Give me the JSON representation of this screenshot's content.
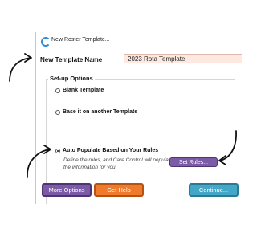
{
  "window": {
    "title": "New Roster Template..."
  },
  "template_name": {
    "label": "New Template Name",
    "value": "2023 Rota Template"
  },
  "setup_options": {
    "caption": "Set-up Options",
    "options": [
      {
        "label": "Blank Template",
        "selected": false
      },
      {
        "label": "Base it on another Template",
        "selected": false
      },
      {
        "label": "Auto Populate Based on Your Rules",
        "selected": true
      }
    ],
    "auto_help": "Define the rules, and Care Control will populate the information for you.",
    "set_rules_label": "Set Rules..."
  },
  "footer": {
    "more_options_label": "More Options",
    "get_help_label": "Get Help",
    "continue_label": "Continue..."
  },
  "colors": {
    "purple_button": "#7b5aa6",
    "orange_button": "#f07a2c",
    "blue_button": "#43a7c8",
    "name_field_bg": "#fde9e0",
    "app_icon": "#2e8bd6"
  },
  "icons": [
    "app-logo-icon",
    "arrow-icon"
  ]
}
